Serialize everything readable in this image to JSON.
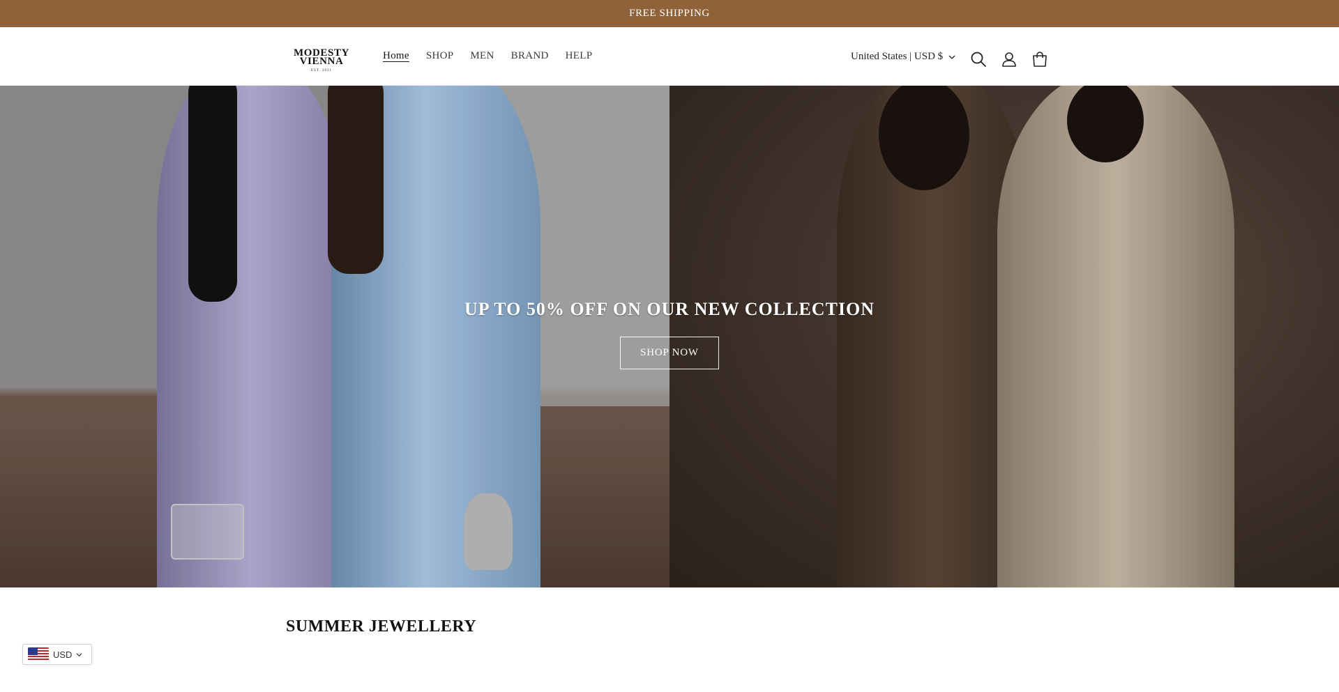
{
  "colors": {
    "announcement_bg": "#8f6239",
    "header_bg": "#ffffff",
    "text": "#1f1f1f",
    "hero_text": "#ffffff"
  },
  "announcement": {
    "text": "FREE SHIPPING"
  },
  "header": {
    "logo": {
      "line1": "MODESTY",
      "line2": "VIENNA",
      "line3": "EST. 2021"
    },
    "nav": [
      {
        "label": "Home",
        "active": true
      },
      {
        "label": "SHOP"
      },
      {
        "label": "MEN"
      },
      {
        "label": "BRAND"
      },
      {
        "label": "HELP"
      }
    ],
    "locale": {
      "label": "United States | USD $",
      "icon": "chevron-down-icon"
    },
    "icons": [
      "search-icon",
      "account-icon",
      "cart-icon"
    ]
  },
  "hero": {
    "heading": "UP TO 50% OFF ON OUR NEW COLLECTION",
    "button_label": "SHOP NOW"
  },
  "section": {
    "title": "SUMMER JEWELLERY"
  },
  "currency_widget": {
    "label": "USD",
    "flag": "us-flag-icon",
    "icon": "chevron-down-icon"
  }
}
